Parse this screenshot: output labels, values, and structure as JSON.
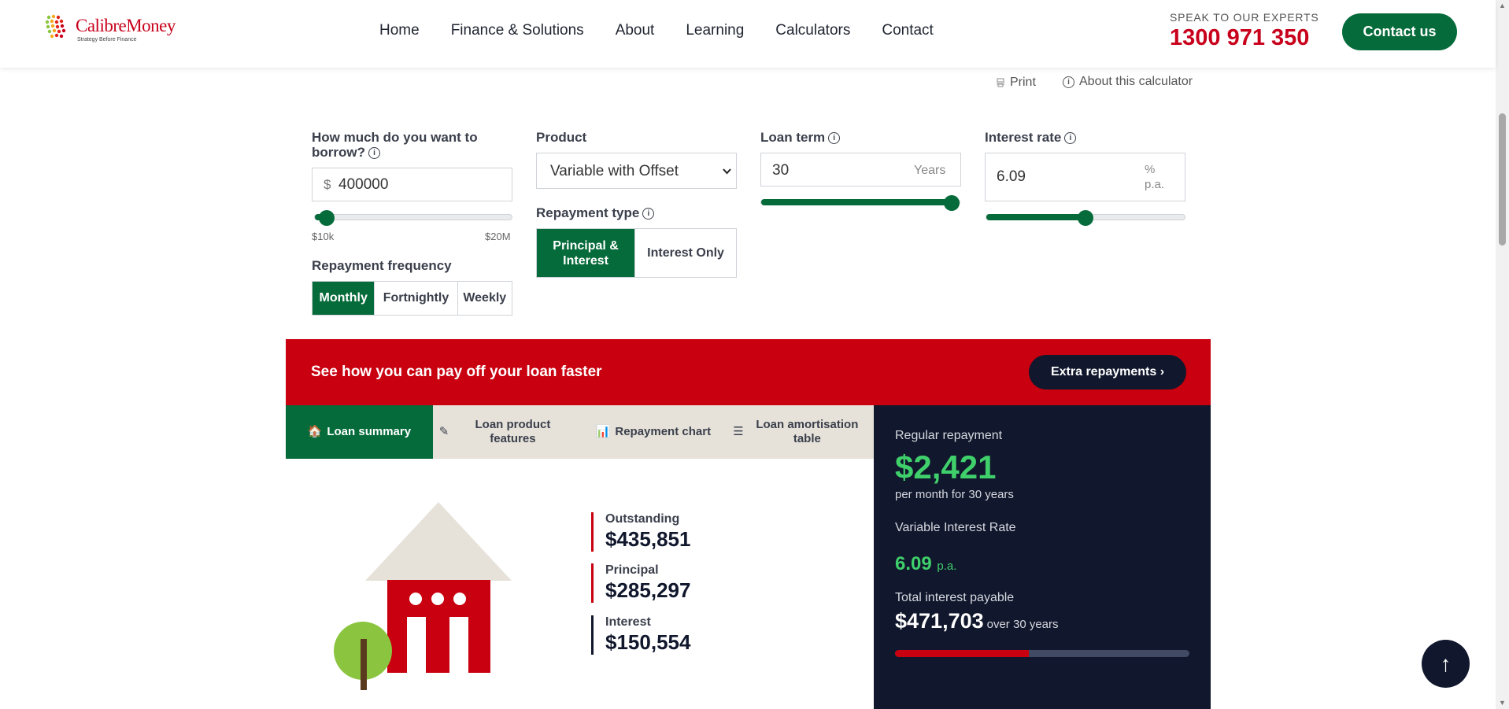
{
  "header": {
    "logo": {
      "brand": "CalibreMoney",
      "tagline": "Strategy Before Finance"
    },
    "nav": [
      "Home",
      "Finance & Solutions",
      "About",
      "Learning",
      "Calculators",
      "Contact"
    ],
    "speak_label": "SPEAK TO OUR EXPERTS",
    "phone": "1300 971 350",
    "contact_button": "Contact us"
  },
  "utility": {
    "print": "Print",
    "about": "About this calculator"
  },
  "form": {
    "borrow": {
      "label": "How much do you want to borrow?",
      "prefix": "$",
      "value": "400000",
      "min_label": "$10k",
      "max_label": "$20M",
      "slider_fraction": 0.02
    },
    "frequency": {
      "label": "Repayment frequency",
      "options": [
        "Monthly",
        "Fortnightly",
        "Weekly"
      ],
      "selected": "Monthly"
    },
    "product": {
      "label": "Product",
      "value": "Variable with Offset"
    },
    "repayment_type": {
      "label": "Repayment type",
      "options": [
        "Principal & Interest",
        "Interest Only"
      ],
      "selected": "Principal & Interest"
    },
    "loan_term": {
      "label": "Loan term",
      "value": "30",
      "unit": "Years",
      "slider_fraction": 1.0
    },
    "interest_rate": {
      "label": "Interest rate",
      "value": "6.09",
      "unit": "% p.a.",
      "slider_fraction": 0.5
    }
  },
  "banner": {
    "text": "See how you can pay off your loan faster",
    "button": "Extra repayments ›"
  },
  "tabs": [
    {
      "icon": "house-emoji",
      "label": "Loan summary",
      "active": true
    },
    {
      "icon": "pencil-emoji",
      "label": "Loan product features",
      "active": false
    },
    {
      "icon": "bar-chart-emoji",
      "label": "Repayment chart",
      "active": false
    },
    {
      "icon": "list-icon",
      "label": "Loan amortisation table",
      "active": false
    }
  ],
  "summary": {
    "outstanding": {
      "label": "Outstanding",
      "value": "$435,851"
    },
    "principal": {
      "label": "Principal",
      "value": "$285,297"
    },
    "interest": {
      "label": "Interest",
      "value": "$150,554"
    }
  },
  "panel": {
    "regular_label": "Regular repayment",
    "regular_value": "$2,421",
    "per_period": "per month for 30 years",
    "rate_label": "Variable Interest Rate",
    "rate_value": "6.09",
    "rate_unit": "p.a.",
    "total_label": "Total interest payable",
    "total_value": "$471,703",
    "total_suffix": "over 30 years",
    "interest_bar_fraction": 0.455
  },
  "colors": {
    "brand_green": "#056b3a",
    "brand_red": "#c8000f",
    "navy": "#11172c",
    "accent_green": "#3fcf6b"
  }
}
